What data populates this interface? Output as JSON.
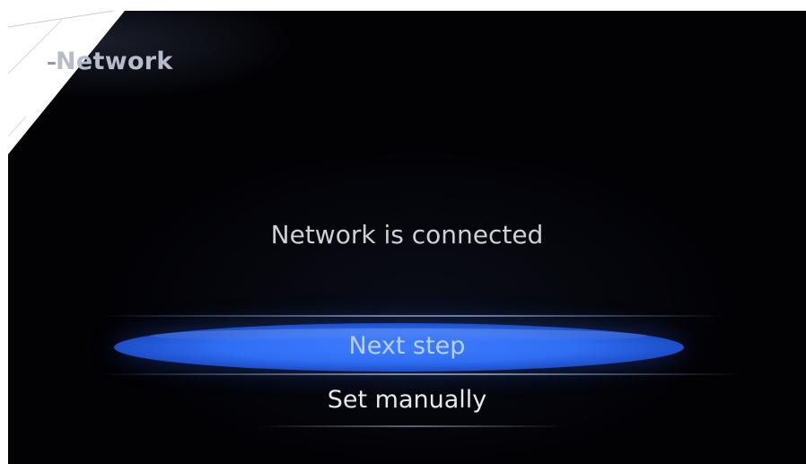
{
  "header": {
    "title": "Network"
  },
  "status": {
    "message": "Network is connected"
  },
  "menu": {
    "items": [
      {
        "label": "Next step",
        "selected": true
      },
      {
        "label": "Set manually",
        "selected": false
      }
    ]
  },
  "colors": {
    "background": "#020205",
    "highlight": "#2f6df2",
    "title_text": "#b6bccb",
    "menu_text": "#e6e8ec",
    "selected_text": "#b9d0ff"
  }
}
